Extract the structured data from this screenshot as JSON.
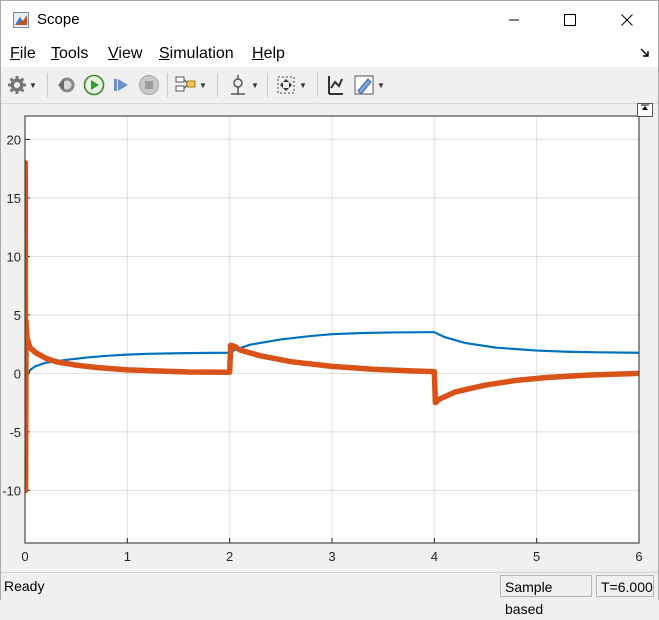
{
  "window": {
    "title": "Scope"
  },
  "menu": {
    "items": [
      {
        "label": "File",
        "key": "F",
        "rest": "ile"
      },
      {
        "label": "Tools",
        "key": "T",
        "rest": "ools"
      },
      {
        "label": "View",
        "key": "V",
        "rest": "iew"
      },
      {
        "label": "Simulation",
        "key": "S",
        "rest": "imulation"
      },
      {
        "label": "Help",
        "key": "H",
        "rest": "elp"
      }
    ]
  },
  "toolbar": {
    "icons": [
      "gear-icon",
      "step-back-icon",
      "run-icon",
      "step-forward-icon",
      "stop-icon",
      "layout-icon",
      "cursor-icon",
      "zoom-fit-icon",
      "scale-axes-icon",
      "highlight-icon"
    ]
  },
  "status": {
    "ready": "Ready",
    "mode": "Sample based",
    "time": "T=6.000"
  },
  "colors": {
    "series1": "#0072bd",
    "series2": "#d95319",
    "accent_run": "#2ca02c"
  },
  "chart_data": {
    "type": "line",
    "title": "",
    "xlabel": "",
    "ylabel": "",
    "xlim": [
      0,
      6
    ],
    "ylim": [
      -14.5,
      22
    ],
    "xticks": [
      "0",
      "1",
      "2",
      "3",
      "4",
      "5",
      "6"
    ],
    "yticks": [
      "-10",
      "-5",
      "0",
      "5",
      "10",
      "15",
      "20"
    ],
    "grid": true,
    "series": [
      {
        "color": "#0072bd",
        "x": [
          0,
          0.005,
          0.02,
          0.05,
          0.1,
          0.2,
          0.4,
          0.6,
          0.8,
          1.0,
          1.2,
          1.5,
          1.8,
          2.0,
          2.05,
          2.2,
          2.5,
          2.8,
          3.0,
          3.3,
          3.6,
          3.9,
          4.0,
          4.1,
          4.3,
          4.6,
          5.0,
          5.3,
          5.6,
          6.0
        ],
        "y": [
          0,
          -2.5,
          -0.2,
          0.3,
          0.6,
          0.9,
          1.15,
          1.35,
          1.5,
          1.6,
          1.67,
          1.72,
          1.75,
          1.76,
          2.0,
          2.45,
          2.9,
          3.2,
          3.35,
          3.45,
          3.5,
          3.52,
          3.52,
          3.1,
          2.6,
          2.2,
          1.95,
          1.85,
          1.8,
          1.76
        ]
      },
      {
        "color": "#d95319",
        "x": [
          0,
          0.003,
          0.006,
          0.01,
          0.02,
          0.05,
          0.1,
          0.2,
          0.3,
          0.5,
          0.7,
          1.0,
          1.3,
          1.6,
          2.0,
          2.01,
          2.05,
          2.1,
          2.3,
          2.6,
          3.0,
          3.4,
          3.8,
          4.0,
          4.01,
          4.05,
          4.2,
          4.5,
          4.8,
          5.1,
          5.5,
          6.0
        ],
        "y": [
          0,
          18,
          -10,
          4.5,
          3,
          2.2,
          1.8,
          1.3,
          1.0,
          0.7,
          0.5,
          0.3,
          0.2,
          0.12,
          0.1,
          2.4,
          2.3,
          2.0,
          1.5,
          1.0,
          0.6,
          0.35,
          0.2,
          0.15,
          -2.5,
          -2.2,
          -1.6,
          -1.0,
          -0.6,
          -0.35,
          -0.15,
          0.0
        ]
      }
    ]
  }
}
